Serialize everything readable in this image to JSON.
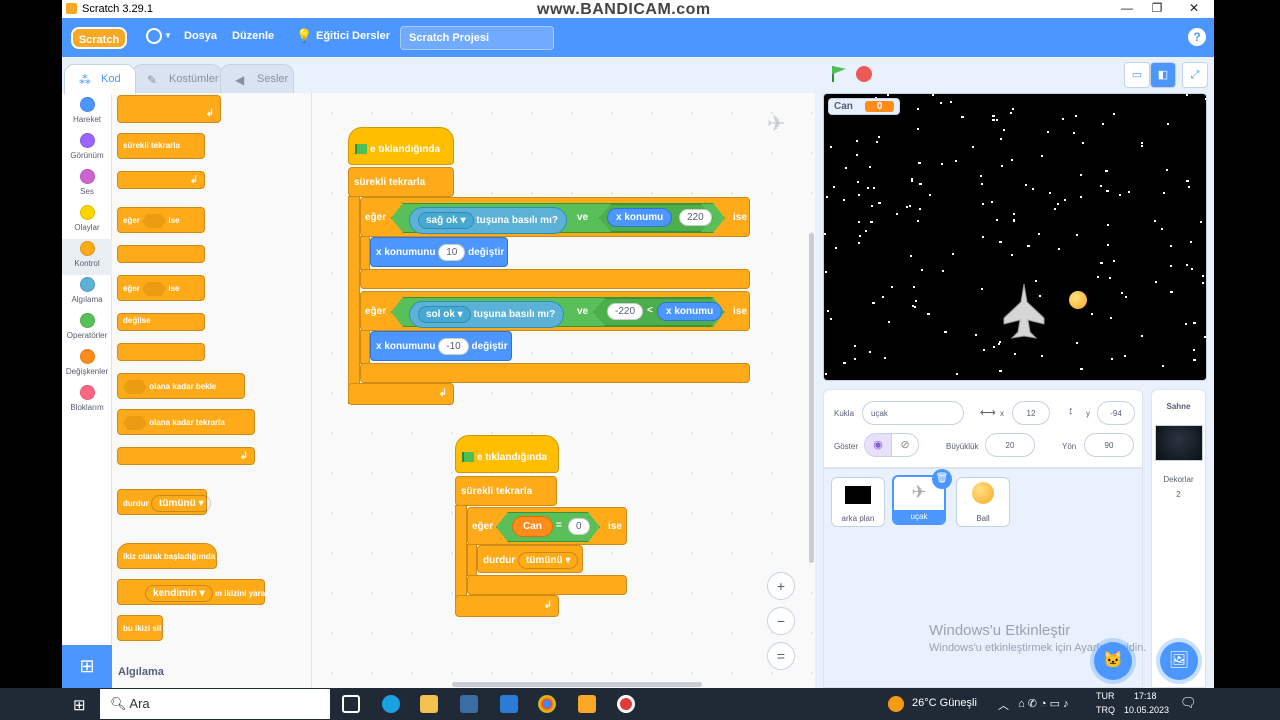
{
  "window": {
    "title": "Scratch 3.29.1",
    "watermark": "www.BANDICAM.com",
    "min": "—",
    "max": "❐",
    "close": "✕"
  },
  "menu": {
    "logo": "Scratch",
    "file": "Dosya",
    "edit": "Düzenle",
    "tutorials": "Eğitici Dersler",
    "project_title": "Scratch Projesi",
    "help": "?"
  },
  "tabs": {
    "code": "Kod",
    "costumes": "Kostümler",
    "sounds": "Sesler"
  },
  "categories": [
    {
      "label": "Hareket",
      "color": "#4c97ff"
    },
    {
      "label": "Görünüm",
      "color": "#9966ff"
    },
    {
      "label": "Ses",
      "color": "#cf63cf"
    },
    {
      "label": "Olaylar",
      "color": "#ffd500"
    },
    {
      "label": "Kontrol",
      "color": "#ffab19"
    },
    {
      "label": "Algılama",
      "color": "#5cb1d6"
    },
    {
      "label": "Operatörler",
      "color": "#59c059"
    },
    {
      "label": "Değişkenler",
      "color": "#ff8c1a"
    },
    {
      "label": "Bloklarım",
      "color": "#ff6680"
    }
  ],
  "palette": {
    "forever": "sürekli tekrarla",
    "if": "eğer",
    "then": "ise",
    "else": "değilse",
    "wait_until": "olana kadar bekle",
    "repeat_until": "olana kadar tekrarla",
    "stop": "durdur",
    "stop_all": "tümünü",
    "clone_start": "ikiz olarak başladığımda",
    "create_clone_me": "kendimin",
    "create_clone_suffix": "ın ikizini yarat",
    "delete_clone": "bu ikizi sil",
    "section_label": "Algılama"
  },
  "script1": {
    "hat": "e tıklandığında",
    "forever": "sürekli tekrarla",
    "if1": {
      "if": "eğer",
      "key": "sağ ok",
      "pressed": "tuşuna basılı mı?",
      "and": "ve",
      "xpos": "x konumu",
      "lt": "<",
      "value": "220",
      "then": "ise"
    },
    "change1": {
      "label": "x konumunu",
      "value": "10",
      "suffix": "değiştir"
    },
    "if2": {
      "if": "eğer",
      "key": "sol ok",
      "pressed": "tuşuna basılı mı?",
      "and": "ve",
      "value": "-220",
      "lt": "<",
      "xpos": "x konumu",
      "then": "ise"
    },
    "change2": {
      "label": "x konumunu",
      "value": "-10",
      "suffix": "değiştir"
    }
  },
  "script2": {
    "hat": "e tıklandığında",
    "forever": "sürekli tekrarla",
    "if": "eğer",
    "var": "Can",
    "eq": "=",
    "value": "0",
    "then": "ise",
    "stop": "durdur",
    "stop_opt": "tümünü"
  },
  "zoom": {
    "in": "+",
    "out": "−",
    "reset": "="
  },
  "stage": {
    "monitor_label": "Can",
    "monitor_value": "0"
  },
  "sprite_info": {
    "sprite_label": "Kukla",
    "sprite_name": "uçak",
    "x_label": "x",
    "x": "12",
    "y_label": "y",
    "y": "-94",
    "show_label": "Göster",
    "size_label": "Büyüklük",
    "size": "20",
    "direction_label": "Yön",
    "direction": "90"
  },
  "sprites": [
    {
      "name": "arka plan"
    },
    {
      "name": "uçak"
    },
    {
      "name": "Ball"
    }
  ],
  "stage_pane": {
    "title": "Sahne",
    "backdrops_label": "Dekorlar",
    "backdrops_count": "2"
  },
  "activation": {
    "title": "Windows'u Etkinleştir",
    "subtitle": "Windows'u etkinleştirmek için Ayarlar'a gidin."
  },
  "taskbar": {
    "search": "Ara",
    "weather": "26°C  Güneşli",
    "lang1": "TUR",
    "lang2": "TRQ",
    "time": "17:18",
    "date": "10.05.2023"
  }
}
